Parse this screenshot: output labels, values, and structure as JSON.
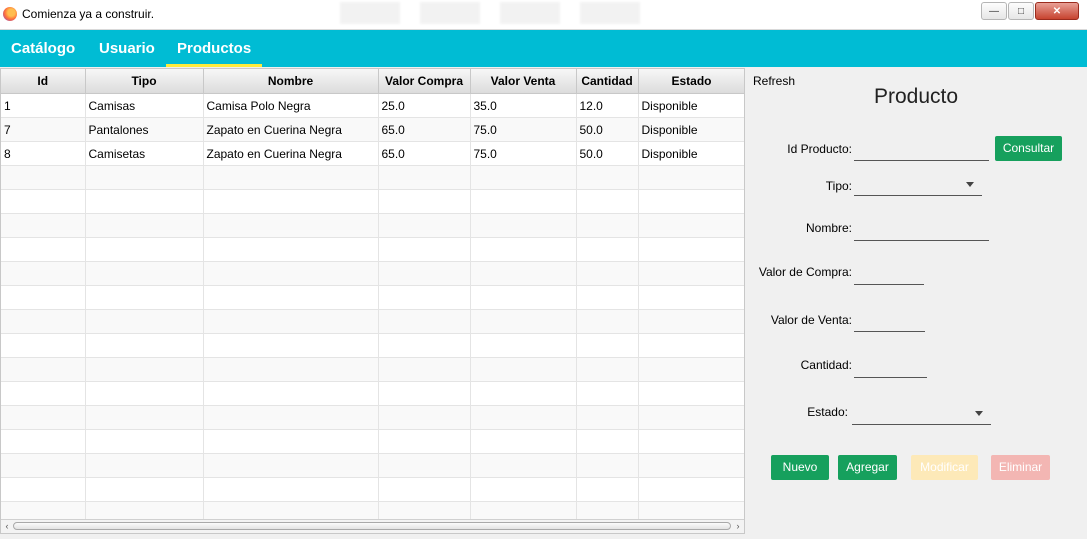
{
  "window": {
    "title": "Comienza ya a construir.",
    "app_icon": "firefox-icon",
    "controls": [
      "minimize",
      "maximize",
      "close"
    ]
  },
  "tabs": [
    {
      "label": "Catálogo",
      "active": false
    },
    {
      "label": "Usuario",
      "active": false
    },
    {
      "label": "Productos",
      "active": true
    }
  ],
  "colors": {
    "tabbar": "#00bcd4",
    "tab_indicator": "#ffeb3b",
    "button_green": "#16a05d",
    "button_disabled_yellow": "#fde9b8",
    "button_disabled_red": "#f3b6b3"
  },
  "table": {
    "columns": [
      "Id",
      "Tipo",
      "Nombre",
      "Valor Compra",
      "Valor Venta",
      "Cantidad",
      "Estado"
    ],
    "rows": [
      [
        "1",
        "Camisas",
        "Camisa Polo Negra",
        "25.0",
        "35.0",
        "12.0",
        "Disponible"
      ],
      [
        "7",
        "Pantalones",
        "Zapato en Cuerina Negra",
        "65.0",
        "75.0",
        "50.0",
        "Disponible"
      ],
      [
        "8",
        "Camisetas",
        "Zapato en Cuerina Negra",
        "65.0",
        "75.0",
        "50.0",
        "Disponible"
      ]
    ],
    "empty_rows": 15
  },
  "form": {
    "refresh_label": "Refresh",
    "title": "Producto",
    "id_label": "Id Producto:",
    "id_value": "",
    "consultar_label": "Consultar",
    "tipo_label": "Tipo:",
    "tipo_value": "",
    "nombre_label": "Nombre:",
    "nombre_value": "",
    "compra_label": "Valor de Compra:",
    "compra_value": "",
    "venta_label": "Valor de Venta:",
    "venta_value": "",
    "cantidad_label": "Cantidad:",
    "cantidad_value": "",
    "estado_label": "Estado:",
    "estado_value": "",
    "buttons": {
      "nuevo": "Nuevo",
      "agregar": "Agregar",
      "modificar": "Modificar",
      "eliminar": "Eliminar"
    }
  }
}
